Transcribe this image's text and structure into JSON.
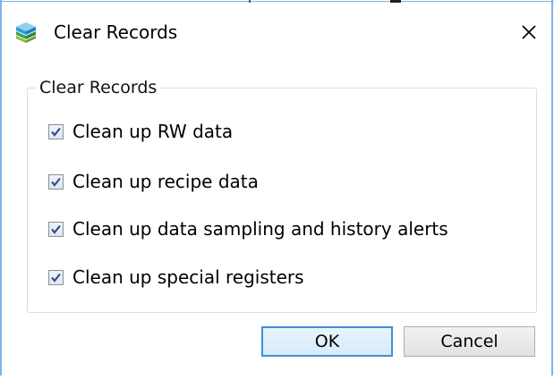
{
  "window": {
    "title": "Clear Records",
    "icon": "app-stack-icon"
  },
  "group": {
    "legend": "Clear Records",
    "options": [
      {
        "label": "Clean up RW data",
        "checked": true
      },
      {
        "label": "Clean up recipe data",
        "checked": true
      },
      {
        "label": "Clean up data sampling and history alerts",
        "checked": true
      },
      {
        "label": "Clean up special registers",
        "checked": true
      }
    ]
  },
  "buttons": {
    "ok_label": "OK",
    "cancel_label": "Cancel"
  },
  "colors": {
    "accent": "#3c8fd9",
    "check": "#3a4c8a",
    "frame": "#7eb4ea"
  }
}
